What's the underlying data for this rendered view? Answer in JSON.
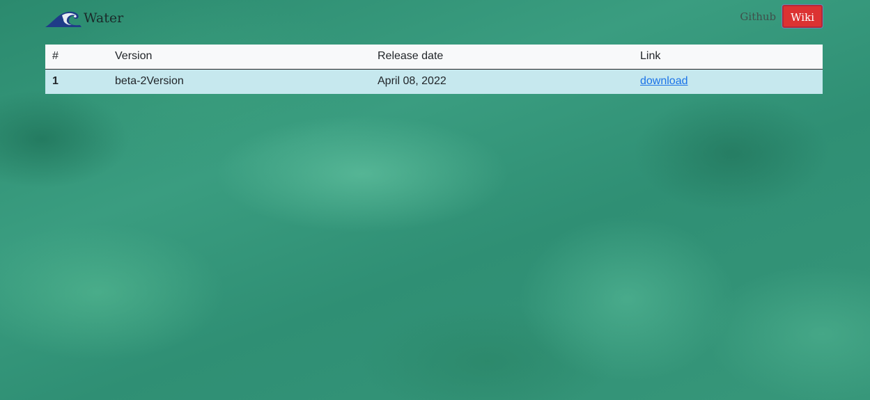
{
  "brand": {
    "name": "Water",
    "logo_icon": "wave-icon"
  },
  "nav": {
    "github_label": "Github",
    "wiki_label": "Wiki",
    "wiki_color": "#dc3232"
  },
  "table": {
    "headers": [
      "#",
      "Version",
      "Release date",
      "Link"
    ],
    "rows": [
      {
        "num": "1",
        "version": "beta-2Version",
        "release_date": "April 08, 2022",
        "link_label": "download"
      }
    ]
  },
  "colors": {
    "background": "#2f8f74",
    "header_row": "#f8f9fa",
    "body_row": "#c6e8ee",
    "link": "#1a73e8"
  }
}
